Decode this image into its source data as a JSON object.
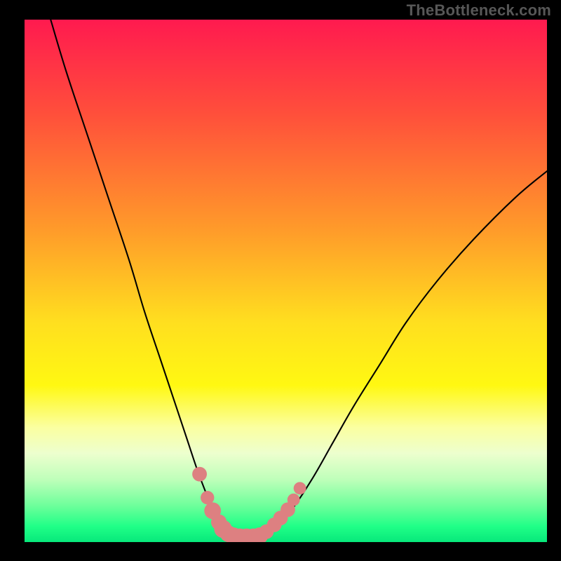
{
  "watermark": "TheBottleneck.com",
  "colors": {
    "background": "#000000",
    "curve": "#000000",
    "markers": "#dd8081",
    "gradient_stops": [
      {
        "offset": 0.0,
        "color": "#ff1a4f"
      },
      {
        "offset": 0.18,
        "color": "#ff4f3b"
      },
      {
        "offset": 0.4,
        "color": "#ff9a2a"
      },
      {
        "offset": 0.58,
        "color": "#ffdf1f"
      },
      {
        "offset": 0.7,
        "color": "#fff812"
      },
      {
        "offset": 0.78,
        "color": "#fbffa0"
      },
      {
        "offset": 0.83,
        "color": "#edffce"
      },
      {
        "offset": 0.88,
        "color": "#bfffba"
      },
      {
        "offset": 0.93,
        "color": "#6eff9b"
      },
      {
        "offset": 0.97,
        "color": "#20ff87"
      },
      {
        "offset": 1.0,
        "color": "#07e87b"
      }
    ]
  },
  "chart_data": {
    "type": "line",
    "title": "",
    "xlabel": "",
    "ylabel": "",
    "xlim": [
      0,
      100
    ],
    "ylim": [
      0,
      100
    ],
    "grid": false,
    "legend": false,
    "series": [
      {
        "name": "bottleneck-curve",
        "x": [
          5,
          8,
          12,
          16,
          20,
          23,
          26,
          29,
          31,
          33,
          34.5,
          36,
          37.5,
          39,
          40.5,
          42,
          44,
          46,
          48,
          51,
          55,
          59,
          63,
          68,
          73,
          79,
          86,
          94,
          100
        ],
        "y": [
          100,
          90,
          78,
          66,
          54,
          44,
          35,
          26,
          20,
          14,
          10,
          6.5,
          4,
          2.3,
          1.3,
          1,
          1,
          1.3,
          2.8,
          6,
          12,
          19,
          26,
          34,
          42,
          50,
          58,
          66,
          71
        ]
      }
    ],
    "markers": [
      {
        "x": 33.5,
        "y": 13,
        "r": 1.4
      },
      {
        "x": 35.0,
        "y": 8.5,
        "r": 1.3
      },
      {
        "x": 36.0,
        "y": 6.0,
        "r": 1.6
      },
      {
        "x": 37.2,
        "y": 3.8,
        "r": 1.5
      },
      {
        "x": 38.0,
        "y": 2.5,
        "r": 1.7
      },
      {
        "x": 39.0,
        "y": 1.6,
        "r": 1.6
      },
      {
        "x": 40.0,
        "y": 1.1,
        "r": 1.7
      },
      {
        "x": 41.2,
        "y": 0.9,
        "r": 1.7
      },
      {
        "x": 42.5,
        "y": 0.9,
        "r": 1.7
      },
      {
        "x": 43.8,
        "y": 0.9,
        "r": 1.7
      },
      {
        "x": 45.0,
        "y": 1.2,
        "r": 1.6
      },
      {
        "x": 46.3,
        "y": 2.0,
        "r": 1.4
      },
      {
        "x": 47.8,
        "y": 3.3,
        "r": 1.4
      },
      {
        "x": 49.0,
        "y": 4.6,
        "r": 1.4
      },
      {
        "x": 50.4,
        "y": 6.2,
        "r": 1.4
      },
      {
        "x": 51.5,
        "y": 8.1,
        "r": 1.2
      },
      {
        "x": 52.7,
        "y": 10.3,
        "r": 1.2
      }
    ]
  }
}
